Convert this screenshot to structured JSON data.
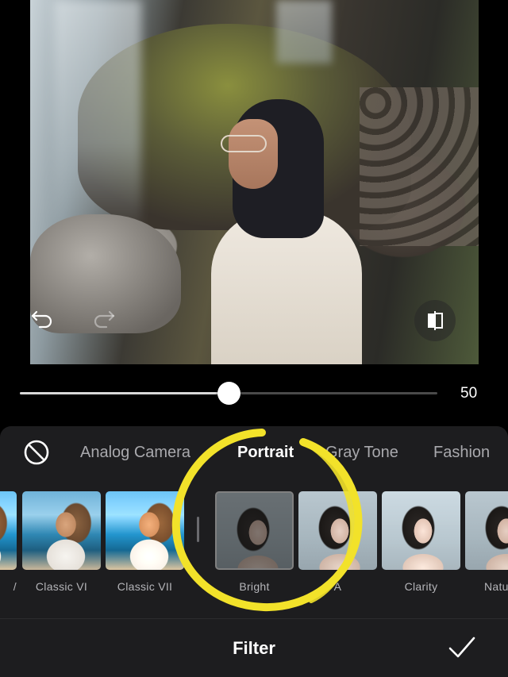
{
  "editor": {
    "intensity_value": "50",
    "intensity_fraction": 0.5
  },
  "categories": [
    {
      "label": "Analog Camera",
      "active": false
    },
    {
      "label": "Portrait",
      "active": true
    },
    {
      "label": "Gray Tone",
      "active": false
    },
    {
      "label": "Fashion",
      "active": false
    }
  ],
  "filters": [
    {
      "label": "/",
      "style": "beach"
    },
    {
      "label": "Classic VI",
      "style": "beach"
    },
    {
      "label": "Classic VII",
      "style": "beach"
    },
    {
      "label": "Bright",
      "style": "portrait-dim",
      "selected": true
    },
    {
      "label": "A",
      "style": "portrait"
    },
    {
      "label": "Clarity",
      "style": "portrait-light"
    },
    {
      "label": "Natu",
      "style": "portrait"
    }
  ],
  "bottom": {
    "title": "Filter"
  },
  "colors": {
    "panel": "#1d1d1f",
    "annotation": "#f2e22a",
    "active_category": "#ffffff",
    "inactive_category": "#a9a9ad"
  },
  "icons": {
    "undo": "undo-icon",
    "redo": "redo-icon",
    "compare": "compare-icon",
    "none": "no-filter-icon",
    "confirm": "checkmark-icon"
  }
}
